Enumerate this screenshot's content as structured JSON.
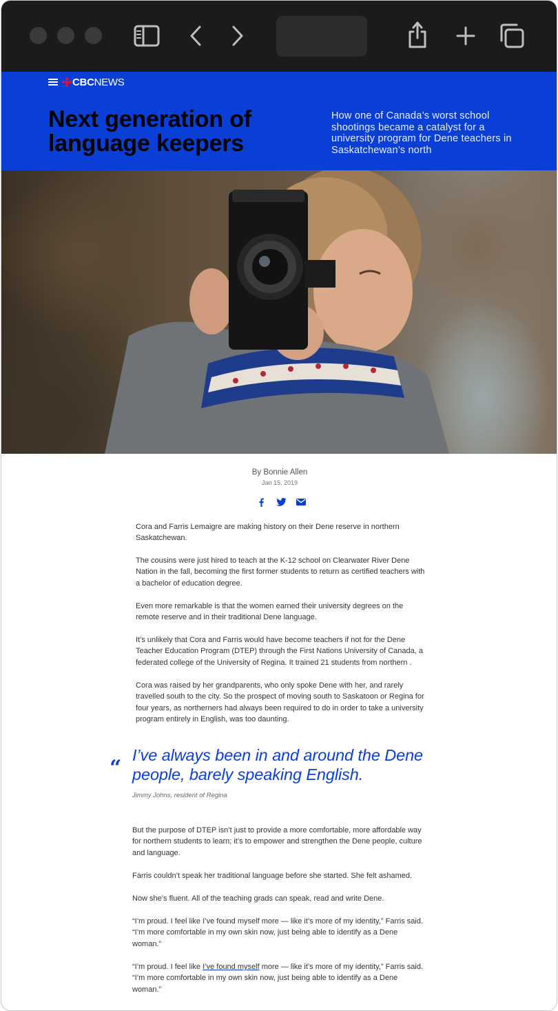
{
  "browser": {
    "icons": {
      "sidebar": "sidebar-icon",
      "back": "chevron-left-icon",
      "forward": "chevron-right-icon",
      "share": "share-icon",
      "new_tab": "plus-icon",
      "tabs": "tabs-icon"
    },
    "address_text": ""
  },
  "header": {
    "logo_bold": "CBC",
    "logo_light": "NEWS",
    "headline": "Next generation of language keepers",
    "dek": "How one of Canada’s worst school shootings became a catalyst for a university program for Dene teachers in Saskatchewan’s north",
    "accent_color": "#0a3fd6"
  },
  "article": {
    "author": "By Bonnie Allen",
    "date": "Jan 15, 2019",
    "share_icons": [
      "facebook-icon",
      "twitter-icon",
      "email-icon"
    ],
    "paragraphs_a": [
      "Cora and Farris Lemaigre are making history on their Dene reserve in northern Saskatchewan.",
      "The cousins were just hired to teach at the K-12 school on Clearwater River Dene Nation in the fall, becoming the first former students to return as certified teachers with a bachelor of education degree.",
      "Even more remarkable is that the women earned their university degrees on the remote reserve and in their traditional Dene language.",
      "It’s unlikely that Cora and Farris would have become teachers if not for the Dene Teacher Education Program (DTEP) through the First Nations University of Canada, a federated college of the University of Regina. It trained 21 students from northern .",
      "Cora was raised by her grandparents, who only spoke Dene with her, and rarely travelled south to the city. So the prospect of moving south to Saskatoon or Regina for four years, as northerners had always been required to do in order to take a university program entirely in English, was too daunting."
    ],
    "pullquote": {
      "mark": "“",
      "text": "I’ve always been in and around the Dene people, barely speaking English.",
      "attribution": "Jimmy Johns, resident of Regina"
    },
    "paragraphs_b": [
      "But the purpose of DTEP isn’t just to provide a more comfortable, more affordable way for northern students to learn; it’s to empower and strengthen the Dene people, culture and language.",
      "Farris couldn’t speak her traditional language before she started. She felt ashamed.",
      "Now she’s fluent. All of the teaching grads can speak, read and write Dene.",
      "“I’m proud. I feel like I’ve found myself more — like it’s more of my identity,” Farris said. “I’m more comfortable in my own skin now, just being able to identify as a Dene woman.”"
    ],
    "last_paragraph": {
      "before_link": "“I’m proud. I feel like ",
      "link_text": "I’ve found myself",
      "after_link": " more — like it’s more of my identity,” Farris said. “I’m more comfortable in my own skin now, just being able to identify as a Dene woman.”"
    }
  }
}
